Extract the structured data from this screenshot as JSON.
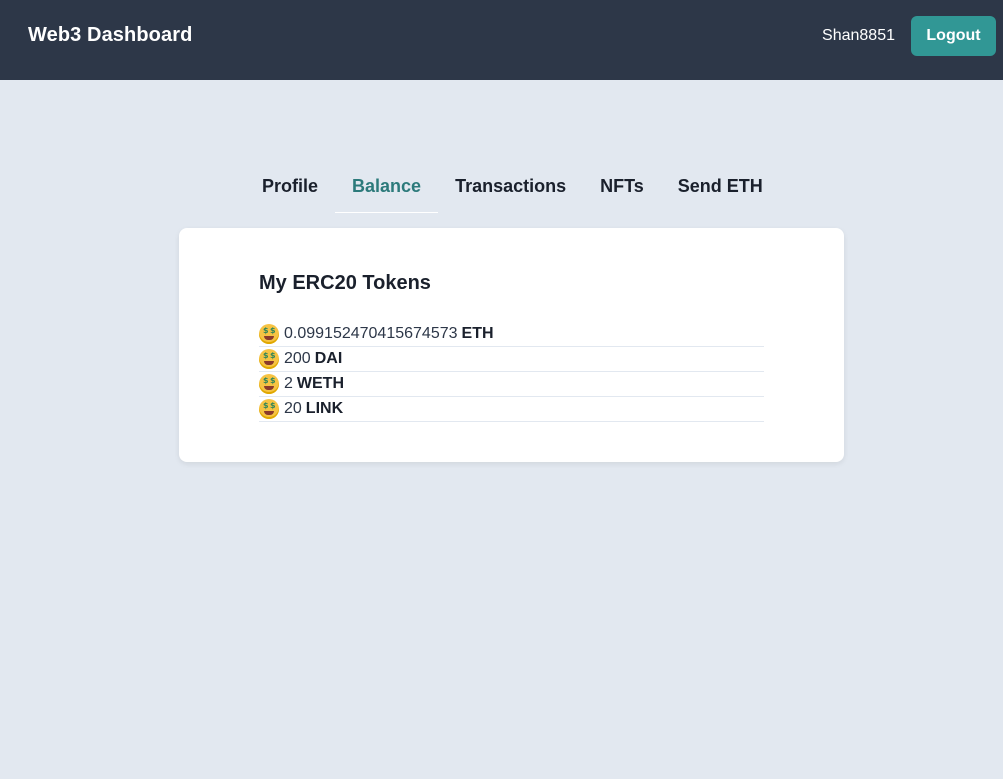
{
  "header": {
    "brand": "Web3 Dashboard",
    "username": "Shan8851",
    "logout_label": "Logout"
  },
  "tabs": [
    {
      "label": "Profile",
      "active": false
    },
    {
      "label": "Balance",
      "active": true
    },
    {
      "label": "Transactions",
      "active": false
    },
    {
      "label": "NFTs",
      "active": false
    },
    {
      "label": "Send ETH",
      "active": false
    }
  ],
  "balance": {
    "title": "My ERC20 Tokens",
    "tokens": [
      {
        "icon": "money-mouth-face-icon",
        "amount": "0.099152470415674573",
        "symbol": "ETH"
      },
      {
        "icon": "money-mouth-face-icon",
        "amount": "200",
        "symbol": "DAI"
      },
      {
        "icon": "money-mouth-face-icon",
        "amount": "2",
        "symbol": "WETH"
      },
      {
        "icon": "money-mouth-face-icon",
        "amount": "20",
        "symbol": "LINK"
      }
    ]
  },
  "colors": {
    "header_bg": "#2d3748",
    "page_bg": "#e2e8f0",
    "accent": "#319795",
    "active_tab": "#2c7a7b"
  }
}
